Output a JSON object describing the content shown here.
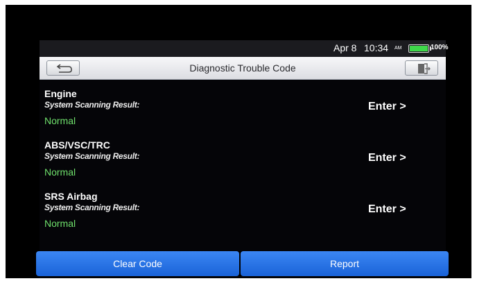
{
  "status_bar": {
    "date": "Apr 8",
    "time": "10:34",
    "ampm": "AM",
    "battery": "100%",
    "battery_level": 1.0,
    "battery_color": "#3fd84a"
  },
  "title_bar": {
    "title": "Diagnostic Trouble Code",
    "back_icon": "back-arrow-icon",
    "exit_icon": "exit-door-icon"
  },
  "systems": [
    {
      "name": "Engine",
      "label": "System Scanning Result:",
      "status": "Normal",
      "action": "Enter >"
    },
    {
      "name": "ABS/VSC/TRC",
      "label": "System Scanning Result:",
      "status": "Normal",
      "action": "Enter >"
    },
    {
      "name": "SRS Airbag",
      "label": "System Scanning Result:",
      "status": "Normal",
      "action": "Enter >"
    }
  ],
  "buttons": {
    "clear_code": "Clear Code",
    "report": "Report"
  },
  "colors": {
    "status_normal": "#6fe06c",
    "button_blue": "#2a72e6"
  }
}
